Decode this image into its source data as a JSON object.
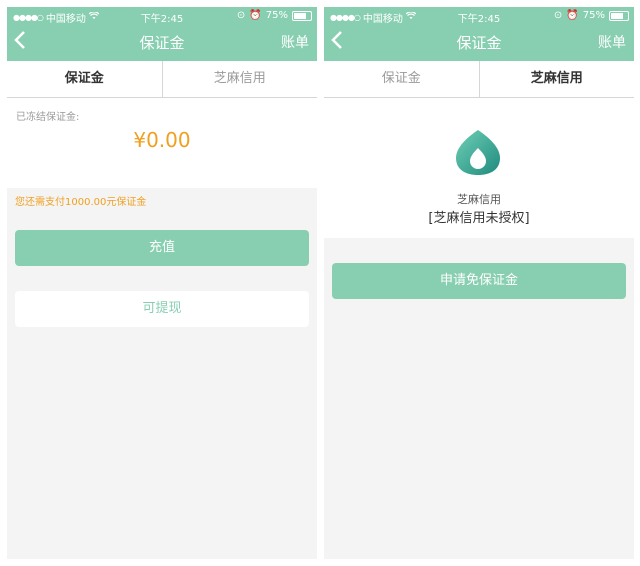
{
  "status_bar": {
    "signal": "●●●●○",
    "carrier": "中国移动",
    "time": "下午2:45",
    "battery_percent": "75%",
    "battery_level": 0.75
  },
  "left_screen": {
    "nav": {
      "back_icon": "chevron-left-icon",
      "title": "保证金",
      "right_label": "账单"
    },
    "tabs": [
      "保证金",
      "芝麻信用"
    ],
    "active_tab": 0,
    "deposit": {
      "label": "已冻结保证金:",
      "amount": "¥0.00"
    },
    "notice": "您还需支付1000.00元保证金",
    "recharge_button": "充值",
    "withdraw_button": "可提现"
  },
  "right_screen": {
    "nav": {
      "back_icon": "chevron-left-icon",
      "title": "保证金",
      "right_label": "账单"
    },
    "tabs": [
      "保证金",
      "芝麻信用"
    ],
    "active_tab": 1,
    "zhima": {
      "logo_icon": "zhima-credit-logo-icon",
      "name": "芝麻信用",
      "status": "[芝麻信用未授权]"
    },
    "apply_button": "申请免保证金"
  },
  "colors": {
    "accent": "#88cfb2",
    "warning": "#f0a020",
    "background": "#f4f4f4"
  }
}
